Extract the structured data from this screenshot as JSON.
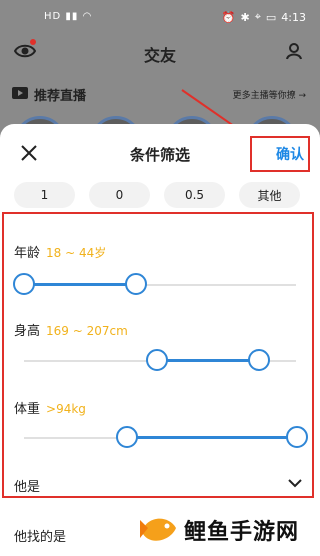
{
  "status_bar": {
    "carrier": "HD",
    "time": "4:13"
  },
  "header": {
    "title": "交友"
  },
  "live": {
    "title": "推荐直播",
    "more": "更多主播等你撩 →"
  },
  "sheet": {
    "title": "条件筛选",
    "confirm_label": "确认",
    "chips": [
      "1",
      "0",
      "0.5",
      "其他"
    ],
    "age": {
      "label": "年龄",
      "value": "18 ~ 44岁",
      "range": [
        18,
        44
      ]
    },
    "height": {
      "label": "身高",
      "value": "169 ~ 207cm",
      "range": [
        169,
        207
      ]
    },
    "weight": {
      "label": "体重",
      "value": ">94kg",
      "range": [
        94
      ]
    },
    "other_label": "他是",
    "looking_label": "他找的是"
  },
  "watermark": {
    "text": "鲤鱼手游网"
  },
  "colors": {
    "accent": "#2f86d6",
    "value_text": "#f1b21c",
    "confirm": "#1e88e5",
    "annotation": "#e0302a"
  }
}
